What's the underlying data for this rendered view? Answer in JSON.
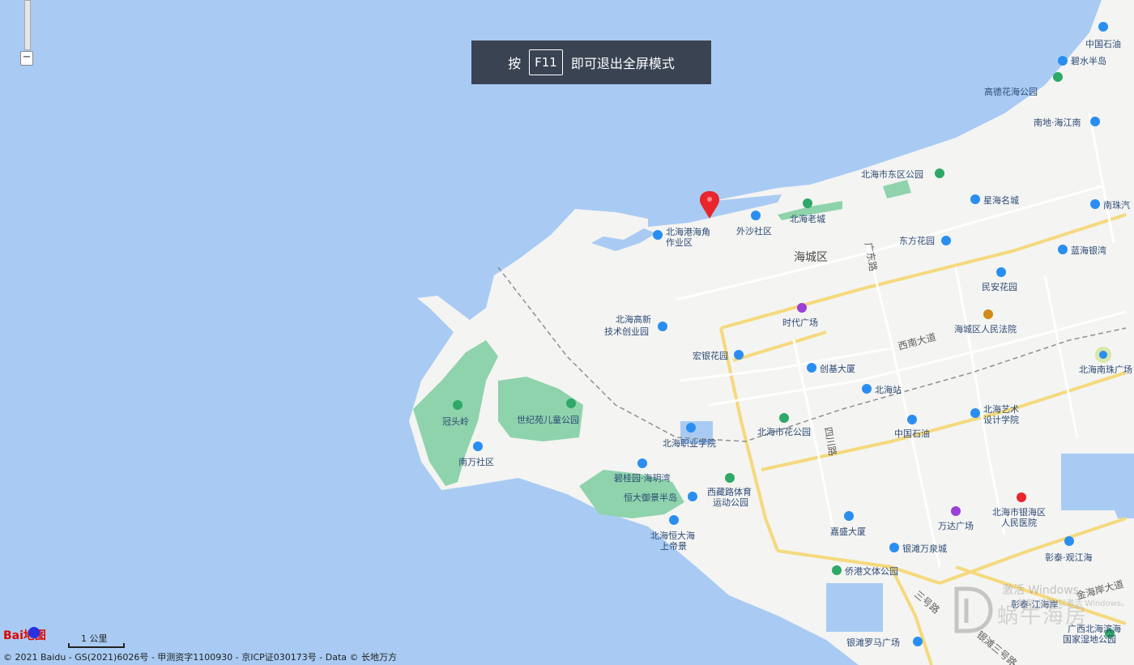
{
  "toast": {
    "prefix": "按",
    "key": "F11",
    "suffix": "即可退出全屏模式"
  },
  "zoom": {
    "minus": "−"
  },
  "scale": {
    "label": "1 公里"
  },
  "logo": {
    "text": "Bai地图"
  },
  "copyright": "© 2021 Baidu - GS(2021)6026号 - 甲测资字1100930 - 京ICP证030173号 - Data © 长地万方",
  "watermark": {
    "activate": "激活 Windows",
    "activate_sub": "转到\"设置\"以激活 Windows。",
    "brand": "蜗牛海房"
  },
  "districts": {
    "haicheng": "海城区"
  },
  "roads": {
    "guangdong": "广东路",
    "xinan": "西南大道",
    "sichuan": "四川路",
    "sanhao": "三号路",
    "yintan_sanhao": "银滩三号路",
    "jinhai": "金海岸大道"
  },
  "pois": [
    {
      "name": "中国石油",
      "icon": "fuel-icon"
    },
    {
      "name": "碧水半岛",
      "icon": "residence-icon"
    },
    {
      "name": "高德花海公园",
      "icon": "park-icon"
    },
    {
      "name": "南地·海江南",
      "icon": "residence-icon"
    },
    {
      "name": "北海市东区公园",
      "icon": "park-icon"
    },
    {
      "name": "星海名城",
      "icon": "residence-icon"
    },
    {
      "name": "南珠汽",
      "icon": "bus-icon"
    },
    {
      "name": "北海老城",
      "icon": "park-icon"
    },
    {
      "name": "外沙社区",
      "icon": "residence-icon"
    },
    {
      "name": "北海港海角",
      "icon": "residence-icon"
    },
    {
      "name": "作业区",
      "icon": ""
    },
    {
      "name": "东方花园",
      "icon": "residence-icon"
    },
    {
      "name": "蓝海银湾",
      "icon": "residence-icon"
    },
    {
      "name": "民安花园",
      "icon": "residence-icon"
    },
    {
      "name": "北海高新",
      "icon": "residence-icon"
    },
    {
      "name": "技术创业园",
      "icon": ""
    },
    {
      "name": "时代广场",
      "icon": "shopping-icon"
    },
    {
      "name": "海城区人民法院",
      "icon": "court-icon"
    },
    {
      "name": "宏银花园",
      "icon": "residence-icon"
    },
    {
      "name": "创基大厦",
      "icon": "building-icon"
    },
    {
      "name": "北海南珠广场",
      "icon": "landmark-icon"
    },
    {
      "name": "北海站",
      "icon": "train-icon"
    },
    {
      "name": "冠头岭",
      "icon": "park-icon"
    },
    {
      "name": "世纪苑儿童公园",
      "icon": "park-icon"
    },
    {
      "name": "北海艺术",
      "icon": "school-icon"
    },
    {
      "name": "设计学院",
      "icon": ""
    },
    {
      "name": "北海市花公园",
      "icon": "park-icon"
    },
    {
      "name": "中国石油",
      "icon": "fuel-icon"
    },
    {
      "name": "南万社区",
      "icon": "residence-icon"
    },
    {
      "name": "北海职业学院",
      "icon": "school-icon"
    },
    {
      "name": "碧桂园·海玥湾",
      "icon": "residence-icon"
    },
    {
      "name": "恒大御景半岛",
      "icon": "residence-icon"
    },
    {
      "name": "西藏路体育",
      "icon": "park-icon"
    },
    {
      "name": "运动公园",
      "icon": ""
    },
    {
      "name": "北海市银海区",
      "icon": "hospital-icon"
    },
    {
      "name": "人民医院",
      "icon": ""
    },
    {
      "name": "万达广场",
      "icon": "shopping-icon"
    },
    {
      "name": "北海恒大海",
      "icon": "residence-icon"
    },
    {
      "name": "上帝景",
      "icon": ""
    },
    {
      "name": "嘉盛大厦",
      "icon": "building-icon"
    },
    {
      "name": "银滩万泉城",
      "icon": "residence-icon"
    },
    {
      "name": "彰泰·观江海",
      "icon": "residence-icon"
    },
    {
      "name": "侨港文体公园",
      "icon": "park-icon"
    },
    {
      "name": "彰泰·江海岸",
      "icon": "residence-icon"
    },
    {
      "name": "广西北海滨海",
      "icon": "park-icon"
    },
    {
      "name": "国家湿地公园",
      "icon": ""
    },
    {
      "name": "银滩罗马广场",
      "icon": "residence-icon"
    }
  ],
  "colors": {
    "sea": "#a9cbf3",
    "land": "#f4f4f2",
    "green": "#8ed3ab",
    "road_major": "#f5d97c",
    "marker": "#e8262b"
  }
}
